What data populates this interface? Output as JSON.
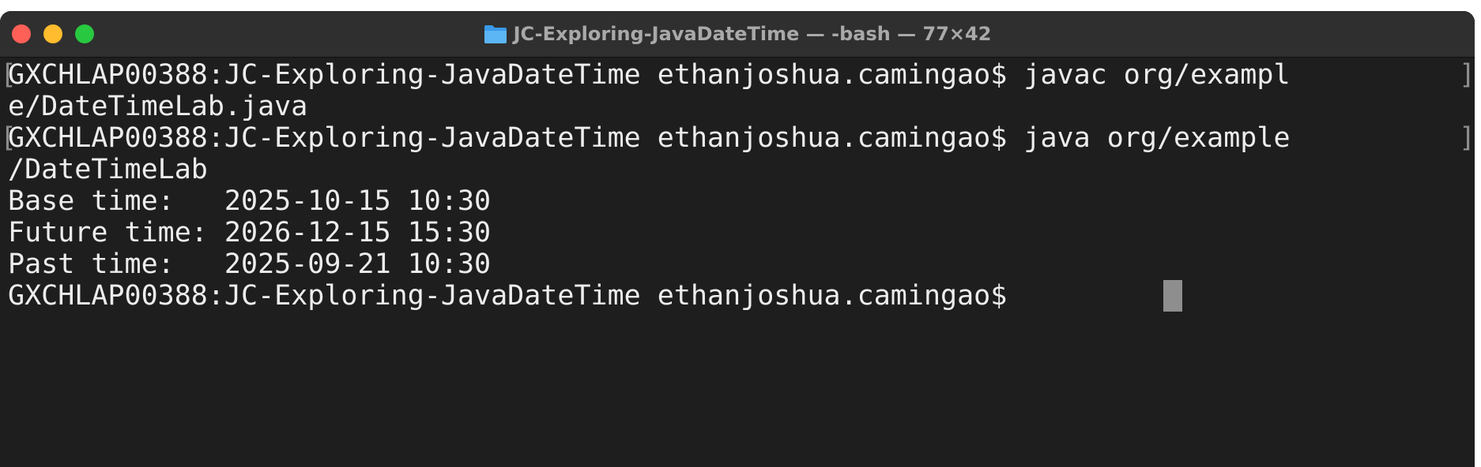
{
  "window": {
    "title": "JC-Exploring-JavaDateTime — -bash — 77×42",
    "folder_icon": "folder-icon",
    "colors": {
      "background": "#1e1e1e",
      "titlebar": "#2f2f2f",
      "text": "#ededed",
      "close": "#fe5f57",
      "minimize": "#febc2e",
      "maximize": "#28c840"
    }
  },
  "terminal": {
    "lines": [
      "GXCHLAP00388:JC-Exploring-JavaDateTime ethanjoshua.camingao$ javac org/exampl",
      "e/DateTimeLab.java",
      "GXCHLAP00388:JC-Exploring-JavaDateTime ethanjoshua.camingao$ java org/example",
      "/DateTimeLab",
      "Base time:   2025-10-15 10:30",
      "Future time: 2026-12-15 15:30",
      "Past time:   2025-09-21 10:30",
      "GXCHLAP00388:JC-Exploring-JavaDateTime ethanjoshua.camingao$ "
    ],
    "wrap_marker_left": "[",
    "wrap_marker_right": "]"
  }
}
